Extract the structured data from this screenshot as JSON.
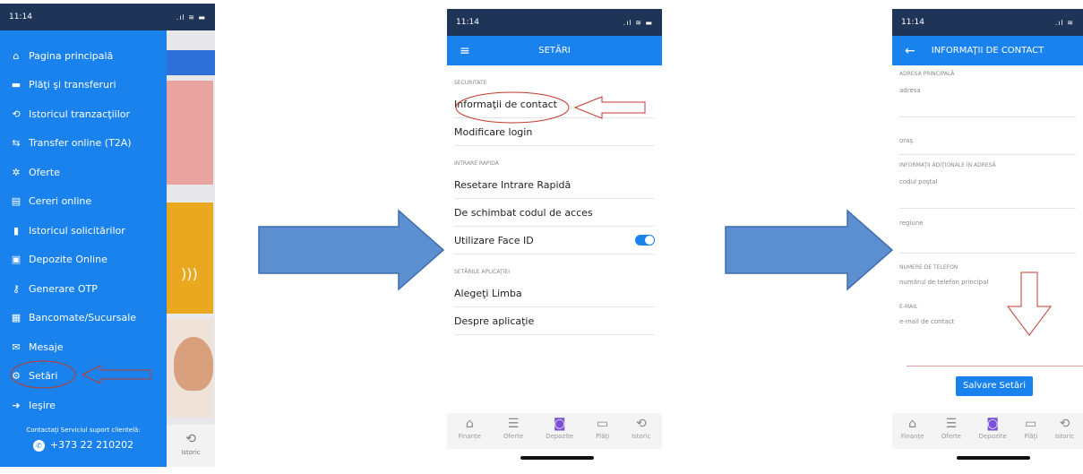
{
  "time": "11:14",
  "colors": {
    "accent": "#1a82ec",
    "dark": "#1f3558",
    "annotation": "#c0392b",
    "arrow": "#5b8fd0"
  },
  "menu": {
    "items": [
      {
        "icon": "home-icon",
        "glyph": "⌂",
        "label": "Pagina principală"
      },
      {
        "icon": "card-icon",
        "glyph": "▬",
        "label": "Plăţi şi transferuri"
      },
      {
        "icon": "history-icon",
        "glyph": "⟲",
        "label": "Istoricul tranzacţiilor"
      },
      {
        "icon": "transfer-icon",
        "glyph": "⇆",
        "label": "Transfer online (T2A)"
      },
      {
        "icon": "offers-icon",
        "glyph": "✲",
        "label": "Oferte"
      },
      {
        "icon": "form-icon",
        "glyph": "▤",
        "label": "Cereri online"
      },
      {
        "icon": "document-icon",
        "glyph": "▮",
        "label": "Istoricul solicitărilor"
      },
      {
        "icon": "deposit-icon",
        "glyph": "▣",
        "label": "Depozite Online"
      },
      {
        "icon": "key-icon",
        "glyph": "⚷",
        "label": "Generare OTP"
      },
      {
        "icon": "atm-icon",
        "glyph": "▦",
        "label": "Bancomate/Sucursale"
      },
      {
        "icon": "mail-icon",
        "glyph": "✉",
        "label": "Mesaje"
      },
      {
        "icon": "gear-icon",
        "glyph": "⚙",
        "label": "Setări"
      },
      {
        "icon": "exit-icon",
        "glyph": "➔",
        "label": "Ieşire"
      }
    ],
    "support_text": "Contactaţi Serviciul suport clientelă:",
    "support_phone": "+373 22 210202",
    "bg_nav_label": "Istoric"
  },
  "settings": {
    "title": "SETĂRI",
    "sections": [
      {
        "header": "SECURITATE",
        "rows": [
          "Informaţii de contact",
          "Modificare login"
        ]
      },
      {
        "header": "INTRARE RAPIDA",
        "rows": [
          "Resetare Intrare Rapidă",
          "De schimbat codul de acces",
          "Utilizare Face ID"
        ]
      },
      {
        "header": "SETĂRILE APLICAŢIEI",
        "rows": [
          "Alegeţi Limba",
          "Despre aplicaţie"
        ]
      }
    ],
    "face_id_enabled": true
  },
  "contact": {
    "title": "INFORMAŢII DE CONTACT",
    "address_header": "ADRESA PRINCIPALĂ",
    "address_field": "adresa",
    "city_field": "oraş",
    "extra_header": "INFORMAŢII ADIŢIONALE ÎN ADRESĂ",
    "postal_field": "codul poştal",
    "region_field": "regiune",
    "phone_header": "NUMERE DE TELEFON",
    "phone_field": "numărul de telefon principal",
    "email_header": "E-MAIL",
    "email_field": "e-mail de contact",
    "save_label": "Salvare Setări"
  },
  "tabbar": [
    {
      "icon": "home-icon",
      "glyph": "⌂",
      "label": "Finanțe"
    },
    {
      "icon": "offers-icon",
      "glyph": "☰",
      "label": "Oferte"
    },
    {
      "icon": "deposit-icon",
      "glyph": "◙",
      "label": "Depozite"
    },
    {
      "icon": "wallet-icon",
      "glyph": "▭",
      "label": "Plăţi"
    },
    {
      "icon": "history-icon",
      "glyph": "⟲",
      "label": "Istoric"
    }
  ]
}
